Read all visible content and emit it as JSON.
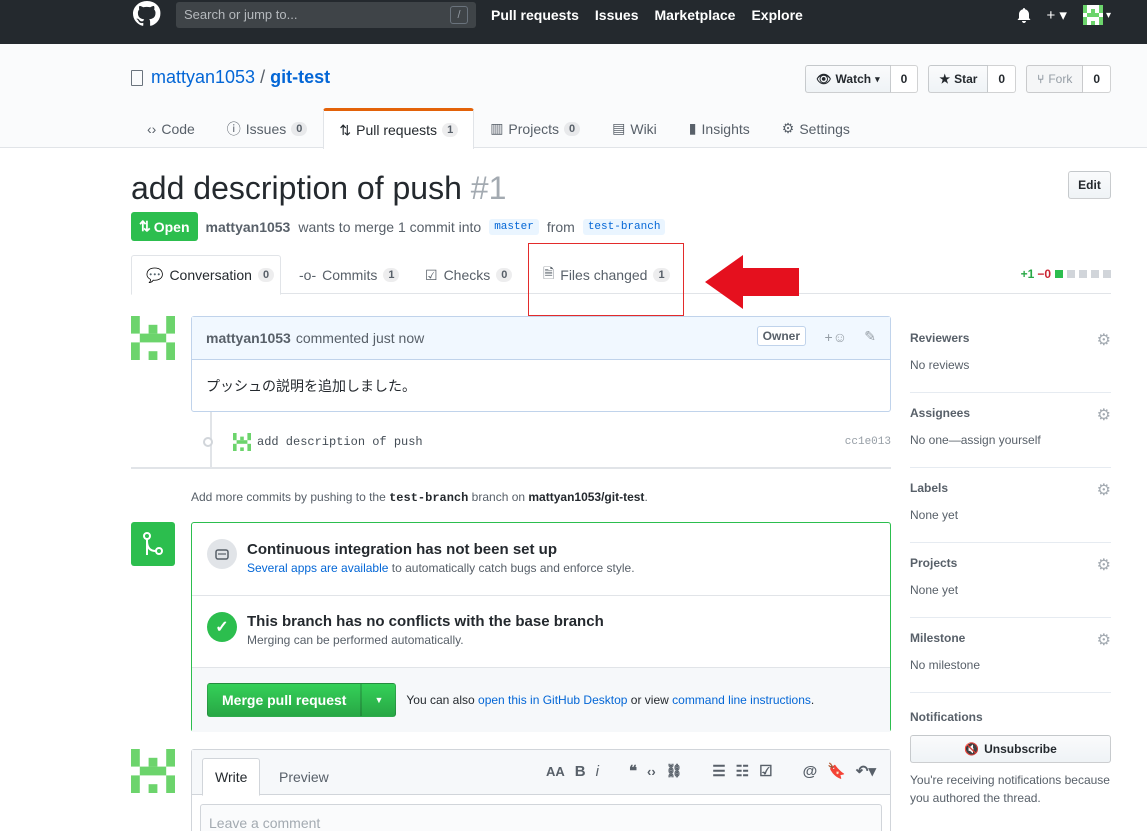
{
  "header": {
    "search_placeholder": "Search or jump to...",
    "search_key": "/",
    "nav": [
      "Pull requests",
      "Issues",
      "Marketplace",
      "Explore"
    ]
  },
  "repo": {
    "owner": "mattyan1053",
    "separator": "/",
    "name": "git-test",
    "watch_label": "Watch",
    "watch_count": "0",
    "star_label": "Star",
    "star_count": "0",
    "fork_label": "Fork",
    "fork_count": "0",
    "tabs": [
      {
        "icon": "code-icon",
        "label": "Code",
        "count": ""
      },
      {
        "icon": "issue-icon",
        "label": "Issues",
        "count": "0"
      },
      {
        "icon": "pull-request-icon",
        "label": "Pull requests",
        "count": "1"
      },
      {
        "icon": "project-icon",
        "label": "Projects",
        "count": "0"
      },
      {
        "icon": "book-icon",
        "label": "Wiki",
        "count": ""
      },
      {
        "icon": "graph-icon",
        "label": "Insights",
        "count": ""
      },
      {
        "icon": "gear-icon",
        "label": "Settings",
        "count": ""
      }
    ]
  },
  "pr": {
    "title": "add description of push",
    "number": "#1",
    "edit_label": "Edit",
    "state": "Open",
    "author": "mattyan1053",
    "meta_text": "wants to merge 1 commit into",
    "base": "master",
    "from_text": "from",
    "head": "test-branch",
    "tabs": [
      {
        "label": "Conversation",
        "count": "0"
      },
      {
        "label": "Commits",
        "count": "1"
      },
      {
        "label": "Checks",
        "count": "0"
      },
      {
        "label": "Files changed",
        "count": "1"
      }
    ],
    "diff_add": "+1",
    "diff_del": "−0"
  },
  "comment": {
    "author": "mattyan1053",
    "time_text": "commented just now",
    "role": "Owner",
    "body": "プッシュの説明を追加しました。"
  },
  "commit": {
    "message": "add description of push",
    "sha": "cc1e013"
  },
  "add_more": {
    "prefix": "Add more commits by pushing to the",
    "branch": "test-branch",
    "middle": "branch on",
    "repo": "mattyan1053/git-test",
    "suffix": "."
  },
  "merge": {
    "ci_title": "Continuous integration has not been set up",
    "ci_link": "Several apps are available",
    "ci_text": "to automatically catch bugs and enforce style.",
    "conflict_title": "This branch has no conflicts with the base branch",
    "conflict_text": "Merging can be performed automatically.",
    "button_label": "Merge pull request",
    "hint_prefix": "You can also",
    "hint_link1": "open this in GitHub Desktop",
    "hint_middle": "or view",
    "hint_link2": "command line instructions",
    "hint_suffix": "."
  },
  "write": {
    "tab_write": "Write",
    "tab_preview": "Preview",
    "placeholder": "Leave a comment"
  },
  "sidebar": {
    "items": [
      {
        "heading": "Reviewers",
        "value": "No reviews"
      },
      {
        "heading": "Assignees",
        "value": "No one—assign yourself"
      },
      {
        "heading": "Labels",
        "value": "None yet"
      },
      {
        "heading": "Projects",
        "value": "None yet"
      },
      {
        "heading": "Milestone",
        "value": "No milestone"
      }
    ],
    "notifications_heading": "Notifications",
    "unsubscribe_label": "Unsubscribe",
    "notifications_text": "You're receiving notifications because you authored the thread."
  },
  "colors": {
    "accent": "#0366d6",
    "open_green": "#2cbe4e",
    "annotation_red": "#e32b2b",
    "header_bg": "#24292e"
  }
}
